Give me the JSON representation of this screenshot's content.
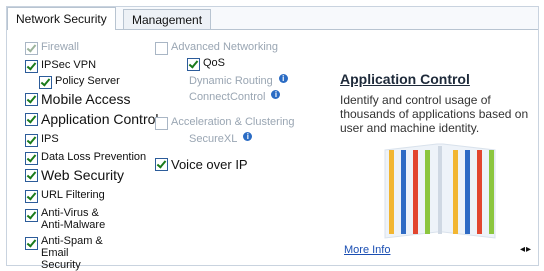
{
  "tabs": [
    {
      "label": "Network Security",
      "active": true
    },
    {
      "label": "Management",
      "active": false
    }
  ],
  "col1": [
    {
      "label": "Firewall",
      "checked": true,
      "disabled": true,
      "big": false,
      "indent": false
    },
    {
      "label": "IPSec VPN",
      "checked": true,
      "disabled": false,
      "big": false,
      "indent": false
    },
    {
      "label": "Policy Server",
      "checked": true,
      "disabled": false,
      "big": false,
      "indent": true
    },
    {
      "label": "Mobile Access",
      "checked": true,
      "disabled": false,
      "big": true,
      "indent": false
    },
    {
      "label": "Application Control",
      "checked": true,
      "disabled": false,
      "big": true,
      "indent": false
    },
    {
      "label": "IPS",
      "checked": true,
      "disabled": false,
      "big": false,
      "indent": false
    },
    {
      "label": "Data Loss Prevention",
      "checked": true,
      "disabled": false,
      "big": false,
      "indent": false
    },
    {
      "label": "Web Security",
      "checked": true,
      "disabled": false,
      "big": true,
      "indent": false
    },
    {
      "label": "URL Filtering",
      "checked": true,
      "disabled": false,
      "big": false,
      "indent": false
    },
    {
      "label": "Anti-Virus & Anti-Malware",
      "checked": true,
      "disabled": false,
      "big": false,
      "indent": false,
      "two": true
    },
    {
      "label": "Anti-Spam & Email Security",
      "checked": true,
      "disabled": false,
      "big": false,
      "indent": false,
      "two": true
    }
  ],
  "col2": {
    "advanced_networking": {
      "label": "Advanced Networking",
      "checked": false
    },
    "qos": {
      "label": "QoS",
      "checked": true
    },
    "dynamic_routing": "Dynamic Routing",
    "connect_control": "ConnectControl",
    "acceleration": {
      "label": "Acceleration & Clustering",
      "checked": false
    },
    "securexl": "SecureXL",
    "voice_over_ip": {
      "label": "Voice over IP",
      "checked": true
    }
  },
  "info_glyph": "i",
  "detail": {
    "title": "Application Control",
    "description": "Identify and control usage of thousands of applications based on user and machine identity.",
    "more_info": "More Info",
    "nav": "◂▸"
  },
  "book_colors": [
    "#f2b632",
    "#2f6bc4",
    "#e2462f",
    "#8cc63f",
    "#f2b632",
    "#2f6bc4",
    "#e2462f",
    "#8cc63f"
  ]
}
